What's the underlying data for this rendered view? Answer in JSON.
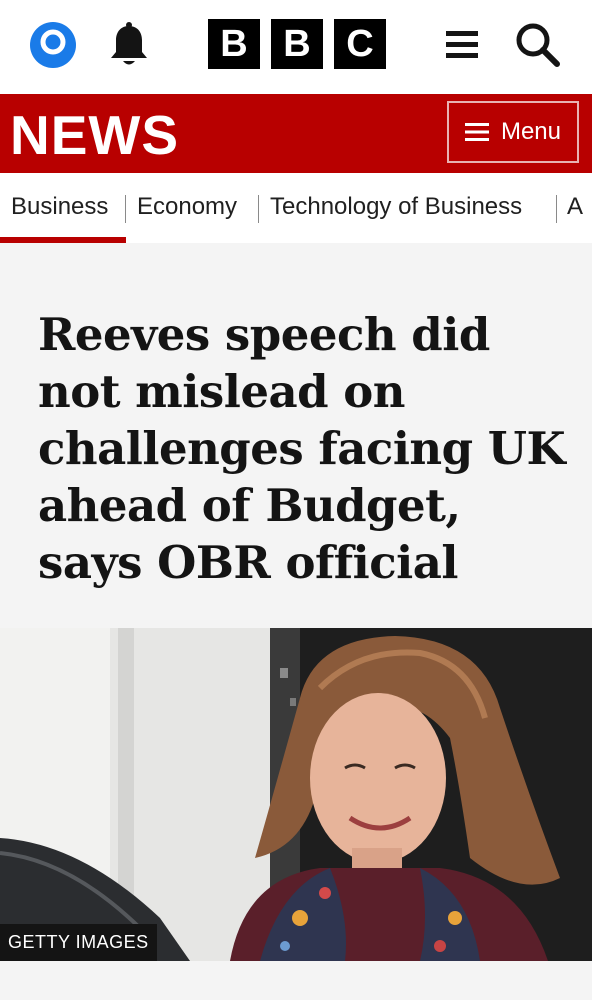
{
  "header": {
    "logo_letters": [
      "B",
      "B",
      "C"
    ],
    "icons": [
      "account-icon",
      "notifications-bell-icon",
      "hamburger-menu-icon",
      "search-icon"
    ]
  },
  "banner": {
    "section": "NEWS",
    "menu_label": "Menu",
    "color": "#b80000"
  },
  "subnav": {
    "items": [
      "Business",
      "Economy",
      "Technology of Business",
      "A"
    ],
    "active": "Business"
  },
  "article": {
    "headline": "Reeves speech did not mislead on challenges facing UK ahead of Budget, says OBR official",
    "image_credit": "GETTY IMAGES"
  }
}
